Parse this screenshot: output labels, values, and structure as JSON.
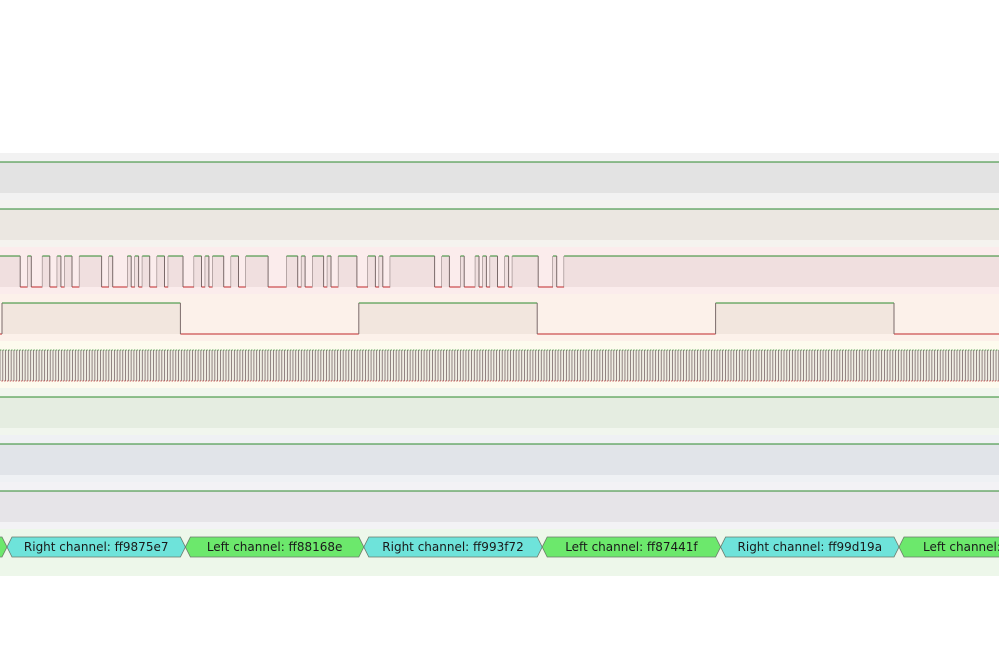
{
  "theme": {
    "line_high": "#2d8a2d",
    "line_low": "#c0282a",
    "edge": "#7a6a6a",
    "ann_right": "#6ee3da",
    "ann_left": "#6ce86c",
    "ann_border": "#6b7a6b"
  },
  "channels": [
    {
      "id": "ch0",
      "bg": "#f2f2f2",
      "band": "#e3e3e3",
      "kind": "flat"
    },
    {
      "id": "ch1",
      "bg": "#f5f3ef",
      "band": "#ebe7e1",
      "kind": "flat"
    },
    {
      "id": "ch2",
      "bg": "#fbecec",
      "band": "#f0dfdf",
      "kind": "data"
    },
    {
      "id": "ch3",
      "bg": "#fcf1ea",
      "band": "#f2e6de",
      "kind": "ws"
    },
    {
      "id": "ch4",
      "bg": "#fdfbee",
      "band": "#f0eee4",
      "kind": "clock"
    },
    {
      "id": "ch5",
      "bg": "#f1f6ee",
      "band": "#e5ede1",
      "kind": "flat"
    },
    {
      "id": "ch6",
      "bg": "#eff1f4",
      "band": "#e1e4e9",
      "kind": "flat"
    },
    {
      "id": "ch7",
      "bg": "#f3f2f5",
      "band": "#e6e4e8",
      "kind": "flat"
    }
  ],
  "annotation_row": {
    "bg": "#edf7ea",
    "items": [
      {
        "label": "",
        "channel": "left"
      },
      {
        "label": "Right channel: ff9875e7",
        "channel": "right"
      },
      {
        "label": "Left channel: ff88168e",
        "channel": "left"
      },
      {
        "label": "Right channel: ff993f72",
        "channel": "right"
      },
      {
        "label": "Left channel: ff87441f",
        "channel": "left"
      },
      {
        "label": "Right channel: ff99d19a",
        "channel": "right"
      },
      {
        "label": "Left channel:",
        "channel": "left"
      }
    ]
  },
  "signals": {
    "data_bits": [
      1,
      1,
      1,
      1,
      1,
      1,
      0,
      0,
      1,
      0,
      0,
      0,
      1,
      1,
      0,
      0,
      1,
      0,
      1,
      1,
      0,
      0,
      1,
      1,
      1,
      1,
      1,
      1,
      0,
      0,
      1,
      0,
      0,
      0,
      0,
      1,
      0,
      1,
      0,
      1,
      1,
      0,
      0,
      1,
      1,
      0,
      1,
      1,
      1,
      1,
      0,
      0,
      0,
      1,
      1,
      0,
      1,
      0,
      1,
      1,
      1,
      0,
      0,
      1,
      1,
      0,
      0,
      1,
      1,
      1,
      1,
      1,
      1,
      0,
      0,
      0,
      0,
      0,
      1,
      1,
      1,
      0,
      1,
      0,
      0,
      1,
      1,
      1,
      0,
      1,
      0,
      0,
      1,
      1,
      1,
      1,
      1,
      0,
      0,
      0,
      1,
      1,
      0,
      1,
      0,
      0,
      1,
      1,
      1,
      1,
      1,
      1,
      1,
      1,
      1,
      1,
      1,
      1,
      0,
      0,
      1,
      1,
      0,
      0,
      0,
      1,
      0,
      0,
      0,
      1,
      0,
      1,
      0,
      1,
      1,
      0,
      0,
      1,
      0,
      1,
      1,
      1,
      1,
      1,
      1,
      1,
      0,
      0,
      0,
      0,
      1,
      0,
      0,
      1
    ],
    "ws_levels": [
      0,
      1,
      0,
      1,
      0,
      1,
      0
    ]
  }
}
